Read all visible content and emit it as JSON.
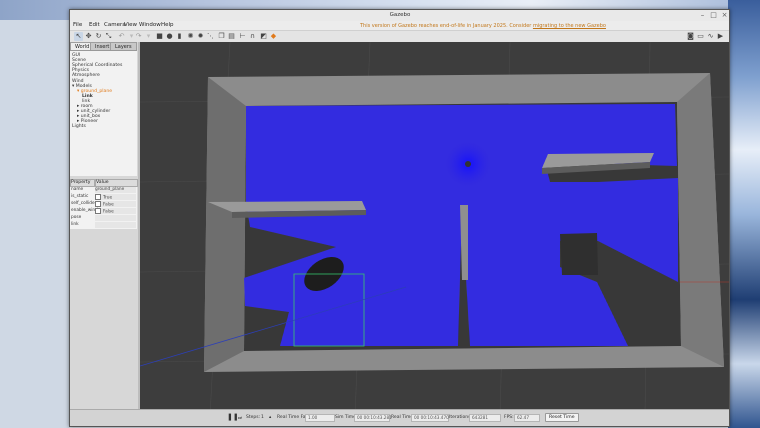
{
  "window": {
    "title": "Gazebo",
    "warning_text": "This version of Gazebo reaches end-of-life in January 2025. Consider",
    "warning_link": "migrating to the new Gazebo"
  },
  "menu": [
    "File",
    "Edit",
    "Camera",
    "View",
    "Window",
    "Help"
  ],
  "toolbar": {
    "tools": [
      "select-icon",
      "translate-icon",
      "rotate-icon",
      "scale-icon",
      "undo-icon",
      "redo-icon",
      "box-icon",
      "sphere-icon",
      "cylinder-icon",
      "point-light-icon",
      "spot-light-icon",
      "directional-light-icon",
      "copy-icon",
      "paste-icon",
      "align-icon",
      "snap-icon",
      "change-view-icon",
      "orange-camera-icon"
    ],
    "right_tools": [
      "screenshot-icon",
      "log-icon",
      "plot-icon",
      "video-icon"
    ]
  },
  "left_panel": {
    "tabs": [
      "World",
      "Insert",
      "Layers"
    ],
    "active_tab": "World",
    "tree": [
      {
        "label": "GUI",
        "indent": 0,
        "expand": ""
      },
      {
        "label": "Scene",
        "indent": 0,
        "expand": ""
      },
      {
        "label": "Spherical Coordinates",
        "indent": 0,
        "expand": ""
      },
      {
        "label": "Physics",
        "indent": 0,
        "expand": ""
      },
      {
        "label": "Atmosphere",
        "indent": 0,
        "expand": ""
      },
      {
        "label": "Wind",
        "indent": 0,
        "expand": ""
      },
      {
        "label": "Models",
        "indent": 0,
        "expand": "▾"
      },
      {
        "label": "ground_plane",
        "indent": 1,
        "expand": "▾",
        "selected": true
      },
      {
        "label": "Link",
        "indent": 2,
        "expand": "",
        "bold": true
      },
      {
        "label": "link",
        "indent": 2,
        "expand": ""
      },
      {
        "label": "room",
        "indent": 1,
        "expand": "▸"
      },
      {
        "label": "unit_cylinder",
        "indent": 1,
        "expand": "▸"
      },
      {
        "label": "unit_box",
        "indent": 1,
        "expand": "▸"
      },
      {
        "label": "Pioneer",
        "indent": 1,
        "expand": "▸"
      },
      {
        "label": "Lights",
        "indent": 0,
        "expand": ""
      }
    ],
    "props_header": {
      "property": "Property",
      "value": "Value"
    },
    "props": [
      {
        "name": "name",
        "value": "ground_plane",
        "check": false
      },
      {
        "name": "is_static",
        "value": "True",
        "check": true
      },
      {
        "name": "self_collide",
        "value": "False",
        "check": true
      },
      {
        "name": "enable_wind",
        "value": "False",
        "check": true
      },
      {
        "name": "pose",
        "value": "",
        "check": false
      },
      {
        "name": "link",
        "value": "",
        "check": false
      }
    ]
  },
  "bottom": {
    "steps_label": "Steps:",
    "steps_value": "1",
    "rtf_label": "Real Time Factor:",
    "rtf_value": "1.00",
    "simtime_label": "Sim Time:",
    "simtime_value": "00 00:10:43.281",
    "realtime_label": "Real Time:",
    "realtime_value": "00 00:10:43.470",
    "iter_label": "Iterations:",
    "iter_value": "643281",
    "fps_label": "FPS:",
    "fps_value": "62.47",
    "reset_label": "Reset Time"
  },
  "colors": {
    "laser": "#2a22e6",
    "wall_top": "#8f8f8f",
    "floor": "#3a3a3a",
    "selection": "#34c26d",
    "warning": "#c2771a"
  }
}
